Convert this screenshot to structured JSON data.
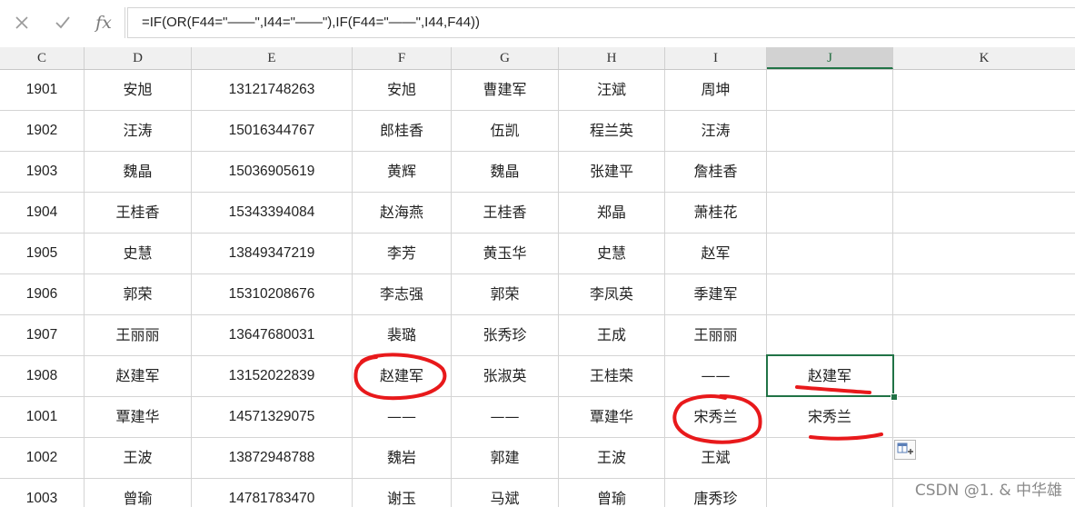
{
  "formula_bar": {
    "cancel_icon": "x-icon",
    "enter_icon": "check-icon",
    "fx_label": "fx",
    "formula": "=IF(OR(F44=\"——\",I44=\"——\"),IF(F44=\"——\",I44,F44))"
  },
  "columns": [
    {
      "id": "C",
      "label": "C"
    },
    {
      "id": "D",
      "label": "D"
    },
    {
      "id": "E",
      "label": "E"
    },
    {
      "id": "F",
      "label": "F"
    },
    {
      "id": "G",
      "label": "G"
    },
    {
      "id": "H",
      "label": "H"
    },
    {
      "id": "I",
      "label": "I"
    },
    {
      "id": "J",
      "label": "J"
    },
    {
      "id": "K",
      "label": "K"
    }
  ],
  "selected_column": "J",
  "rows": [
    {
      "C": "1901",
      "D": "安旭",
      "E": "13121748263",
      "F": "安旭",
      "G": "曹建军",
      "H": "汪斌",
      "I": "周坤",
      "J": ""
    },
    {
      "C": "1902",
      "D": "汪涛",
      "E": "15016344767",
      "F": "郎桂香",
      "G": "伍凯",
      "H": "程兰英",
      "I": "汪涛",
      "J": ""
    },
    {
      "C": "1903",
      "D": "魏晶",
      "E": "15036905619",
      "F": "黄辉",
      "G": "魏晶",
      "H": "张建平",
      "I": "詹桂香",
      "J": ""
    },
    {
      "C": "1904",
      "D": "王桂香",
      "E": "15343394084",
      "F": "赵海燕",
      "G": "王桂香",
      "H": "郑晶",
      "I": "萧桂花",
      "J": ""
    },
    {
      "C": "1905",
      "D": "史慧",
      "E": "13849347219",
      "F": "李芳",
      "G": "黄玉华",
      "H": "史慧",
      "I": "赵军",
      "J": ""
    },
    {
      "C": "1906",
      "D": "郭荣",
      "E": "15310208676",
      "F": "李志强",
      "G": "郭荣",
      "H": "李凤英",
      "I": "季建军",
      "J": ""
    },
    {
      "C": "1907",
      "D": "王丽丽",
      "E": "13647680031",
      "F": "裴璐",
      "G": "张秀珍",
      "H": "王成",
      "I": "王丽丽",
      "J": ""
    },
    {
      "C": "1908",
      "D": "赵建军",
      "E": "13152022839",
      "F": "赵建军",
      "G": "张淑英",
      "H": "王桂荣",
      "I": "——",
      "J": "赵建军"
    },
    {
      "C": "1001",
      "D": "覃建华",
      "E": "14571329075",
      "F": "——",
      "G": "——",
      "H": "覃建华",
      "I": "宋秀兰",
      "J": "宋秀兰"
    },
    {
      "C": "1002",
      "D": "王波",
      "E": "13872948788",
      "F": "魏岩",
      "G": "郭建",
      "H": "王波",
      "I": "王斌",
      "J": ""
    },
    {
      "C": "1003",
      "D": "曾瑜",
      "E": "14781783470",
      "F": "谢玉",
      "G": "马斌",
      "H": "曾瑜",
      "I": "唐秀珍",
      "J": ""
    }
  ],
  "quick_analysis_icon": "quick-analysis-icon",
  "annotation_color": "#e8191b",
  "watermark": "CSDN @1. & 中华雄"
}
